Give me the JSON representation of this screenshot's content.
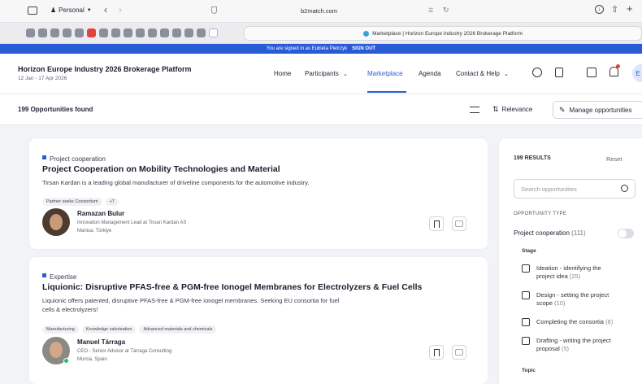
{
  "browser": {
    "profile": "Personal",
    "url": "b2match.com",
    "tab_title": "Marketplace | Horizon Europe Industry 2026 Brokerage Platform"
  },
  "signed_bar": {
    "text": "You are signed in as Eubieta Pietrzyk",
    "signout": "SIGN OUT"
  },
  "header": {
    "event_title": "Horizon Europe Industry 2026 Brokerage Platform",
    "event_dates": "12 Jan - 17 Apr 2026",
    "nav": [
      "Home",
      "Participants",
      "Marketplace",
      "Agenda",
      "Contact & Help"
    ],
    "active_nav": "Marketplace",
    "avatar_initial": "E"
  },
  "subbar": {
    "count_text": "199 Opportunities found",
    "sort_label": "Relevance",
    "manage_label": "Manage opportunities"
  },
  "cards": [
    {
      "type": "Project cooperation",
      "title": "Project Cooperation on Mobility Technologies and Material",
      "desc": "Tirsan Kardan is a leading global manufacturer of driveline components for the automotive industry.",
      "tags": [
        "Partner seeks Consortium",
        "+7"
      ],
      "person_name": "Ramazan Bulur",
      "person_role": "Innovation Management Lead at Tirsan Kardan AS",
      "person_location": "Manisa, Türkiye"
    },
    {
      "type": "Expertise",
      "title": "Liquionic: Disruptive PFAS-free & PGM-free Ionogel Membranes for Electrolyzers & Fuel Cells",
      "desc_line1": "Liquionic offers patented, disruptive PFAS-free & PGM-free ionogel membranes. Seeking EU consortia for fuel",
      "desc_line2": "cells & electrolyzers!",
      "tags": [
        "Manufacturing",
        "Knowledge valorisation",
        "Advanced materials and chemicals"
      ],
      "person_name": "Manuel Tárraga",
      "person_role": "CEO - Senior Advisor at Tárraga Consulting",
      "person_location": "Murcia, Spain"
    }
  ],
  "filters": {
    "results_label": "199 RESULTS",
    "reset_label": "Reset",
    "search_placeholder": "Search opportunities",
    "type_heading": "OPPORTUNITY TYPE",
    "project_coop": "Project cooperation",
    "project_coop_count": "(111)",
    "stage_heading": "Stage",
    "stages": [
      {
        "line1": "Ideation - identifying the",
        "line2": "project idea",
        "count": "(25)"
      },
      {
        "line1": "Design - setting the project",
        "line2": "scope",
        "count": "(10)"
      },
      {
        "line1": "Completing the consortia",
        "line2": "",
        "count": "(8)"
      },
      {
        "line1": "Drafting - writing the project",
        "line2": "proposal",
        "count": "(5)"
      }
    ],
    "topic_heading": "Topic"
  },
  "colors": {
    "accent": "#2a5bd7"
  }
}
